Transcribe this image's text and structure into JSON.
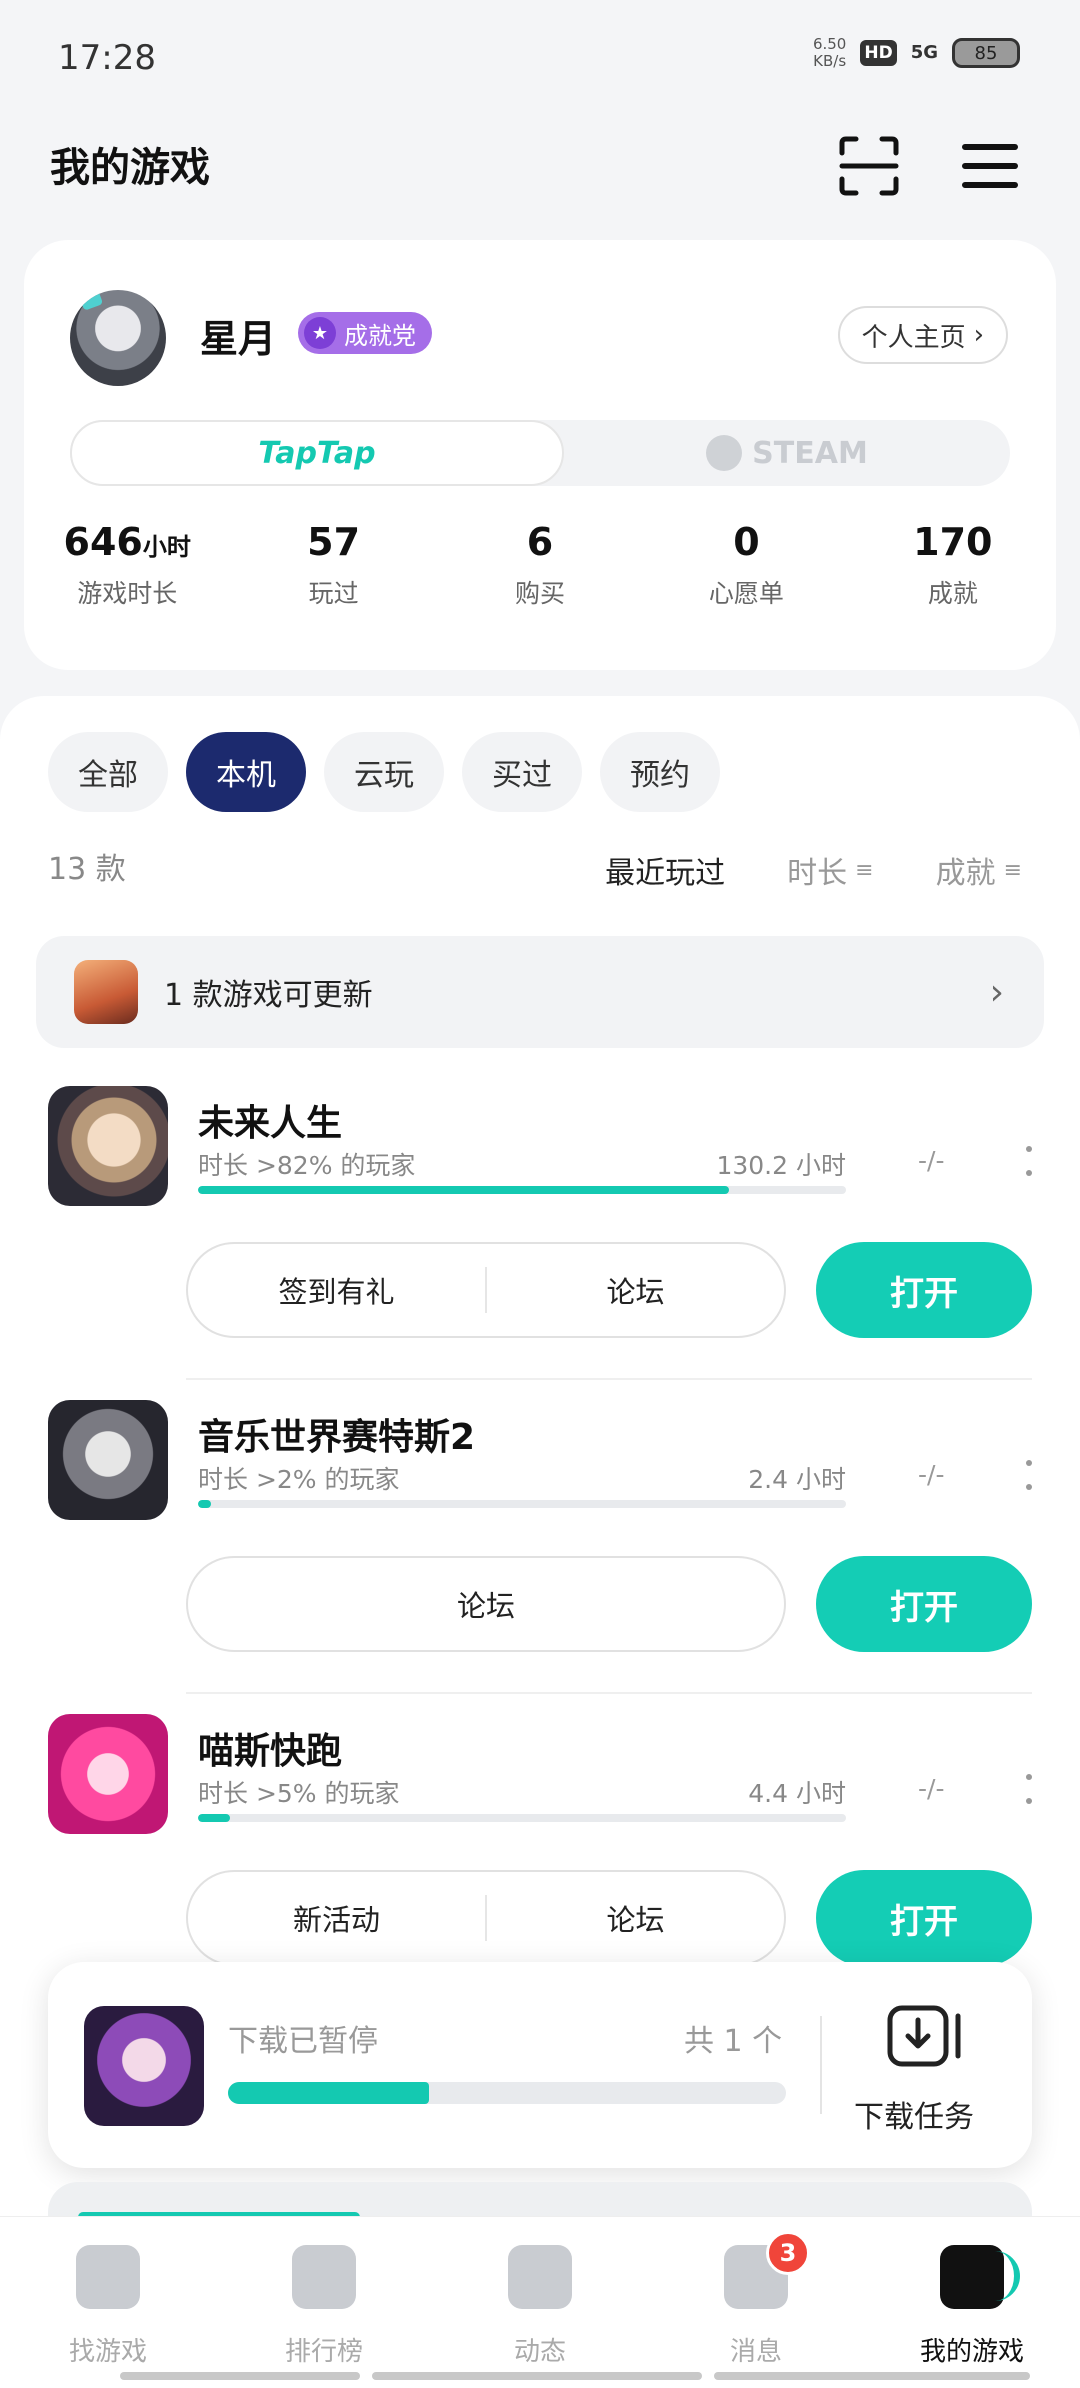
{
  "status_bar": {
    "time": "17:28",
    "net_speed_value": "6.50",
    "net_speed_unit": "KB/s",
    "hd": "HD",
    "network": "5G",
    "battery": "85"
  },
  "header": {
    "title": "我的游戏"
  },
  "profile": {
    "username": "星月",
    "badge": "成就党",
    "homepage_button": "个人主页",
    "platforms": [
      "TapTap",
      "STEAM"
    ],
    "stats": [
      {
        "value": "646",
        "unit": "小时",
        "label": "游戏时长"
      },
      {
        "value": "57",
        "unit": "",
        "label": "玩过"
      },
      {
        "value": "6",
        "unit": "",
        "label": "购买"
      },
      {
        "value": "0",
        "unit": "",
        "label": "心愿单"
      },
      {
        "value": "170",
        "unit": "",
        "label": "成就"
      }
    ]
  },
  "filters": [
    "全部",
    "本机",
    "云玩",
    "买过",
    "预约"
  ],
  "game_count": "13 款",
  "sorts": [
    "最近玩过",
    "时长",
    "成就"
  ],
  "update_bar": {
    "text": "1 款游戏可更新"
  },
  "games": [
    {
      "name": "未来人生",
      "subtitle": "时长 >82% 的玩家",
      "hours": "130.2 小时",
      "achievement": "-/-",
      "progress": 0.82,
      "actions": [
        "签到有礼",
        "论坛"
      ],
      "open": "打开"
    },
    {
      "name": "音乐世界赛特斯2",
      "subtitle": "时长 >2% 的玩家",
      "hours": "2.4 小时",
      "achievement": "-/-",
      "progress": 0.02,
      "actions": [
        "论坛"
      ],
      "open": "打开"
    },
    {
      "name": "喵斯快跑",
      "subtitle": "时长 >5% 的玩家",
      "hours": "4.4 小时",
      "achievement": "-/-",
      "progress": 0.05,
      "actions": [
        "新活动",
        "论坛"
      ],
      "open": "打开"
    }
  ],
  "download": {
    "status": "下载已暂停",
    "total": "共 1 个",
    "progress": 0.36,
    "label": "下载任务"
  },
  "bottom_nav": [
    {
      "label": "找游戏",
      "icon": "find-games-icon"
    },
    {
      "label": "排行榜",
      "icon": "ranking-icon"
    },
    {
      "label": "动态",
      "icon": "feed-icon"
    },
    {
      "label": "消息",
      "icon": "message-icon",
      "badge": "3"
    },
    {
      "label": "我的游戏",
      "icon": "my-games-icon"
    }
  ],
  "colors": {
    "accent": "#14cdb5",
    "active_chip": "#1c2a6e",
    "badge": "#a56ee8",
    "notification": "#f0453a"
  }
}
